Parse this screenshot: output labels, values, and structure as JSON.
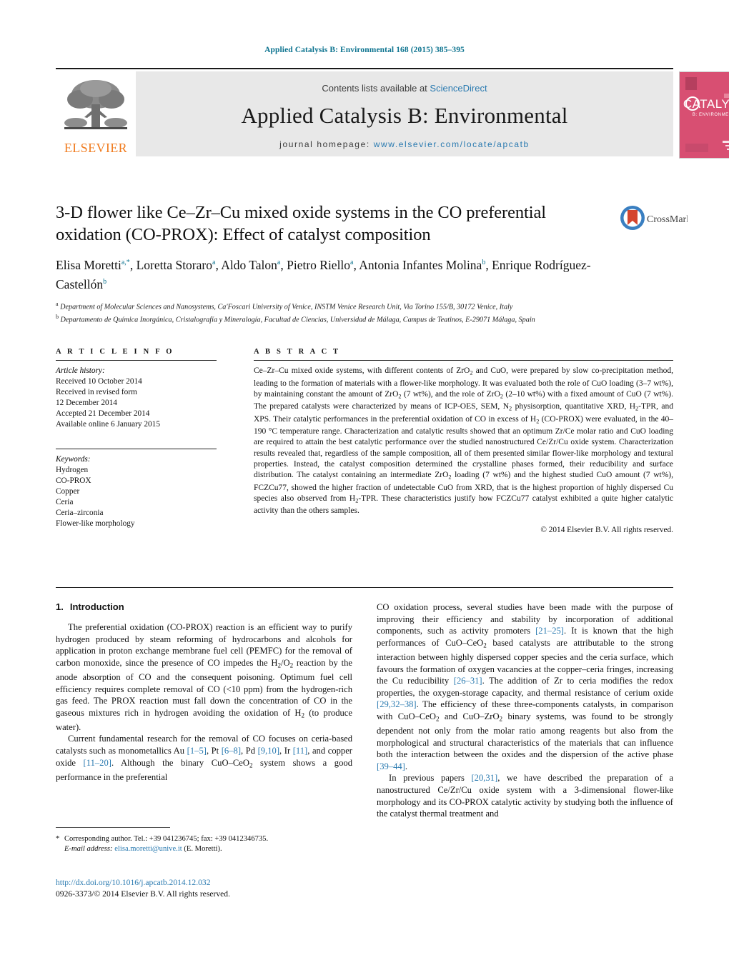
{
  "running_head": "Applied Catalysis B: Environmental 168 (2015) 385–395",
  "masthead": {
    "contents_prefix": "Contents lists available at ",
    "contents_link": "ScienceDirect",
    "journal_title": "Applied Catalysis B: Environmental",
    "homepage_prefix": "journal homepage: ",
    "homepage_url": "www.elsevier.com/locate/apcatb",
    "publisher_name": "ELSEVIER",
    "cover_title": "CATALYSIS",
    "cover_subtitle": "B: ENVIRONMENTAL"
  },
  "crossmark": {
    "label": "CrossMark"
  },
  "article": {
    "title": "3-D flower like Ce–Zr–Cu mixed oxide systems in the CO preferential oxidation (CO-PROX): Effect of catalyst composition",
    "authors_html": "Elisa Moretti<sup>a,*</sup>, Loretta Storaro<sup>a</sup>, Aldo Talon<sup>a</sup>, Pietro Riello<sup>a</sup>, Antonia Infantes Molina<sup>b</sup>, Enrique Rodríguez-Castellón<sup>b</sup>",
    "affiliation_a": "Department of Molecular Sciences and Nanosystems, Ca'Foscari University of Venice, INSTM Venice Research Unit, Via Torino 155/B, 30172 Venice, Italy",
    "affiliation_b": "Departamento de Química Inorgánica, Cristalografía y Mineralogía, Facultad de Ciencias, Universidad de Málaga, Campus de Teatinos, E-29071 Málaga, Spain"
  },
  "article_info": {
    "heading": "A R T I C L E   I N F O",
    "history_title": "Article history:",
    "history": [
      "Received 10 October 2014",
      "Received in revised form",
      "12 December 2014",
      "Accepted 21 December 2014",
      "Available online 6 January 2015"
    ],
    "keywords_title": "Keywords:",
    "keywords": [
      "Hydrogen",
      "CO-PROX",
      "Copper",
      "Ceria",
      "Ceria–zirconia",
      "Flower-like morphology"
    ]
  },
  "abstract": {
    "heading": "A B S T R A C T",
    "text_html": "Ce–Zr–Cu mixed oxide systems, with different contents of ZrO<sub>2</sub> and CuO, were prepared by slow co-precipitation method, leading to the formation of materials with a flower-like morphology. It was evaluated both the role of CuO loading (3–7 wt%), by maintaining constant the amount of ZrO<sub>2</sub> (7 wt%), and the role of ZrO<sub>2</sub> (2–10 wt%) with a fixed amount of CuO (7 wt%). The prepared catalysts were characterized by means of ICP-OES, SEM, N<sub>2</sub> physisorption, quantitative XRD, H<sub>2</sub>-TPR, and XPS. Their catalytic performances in the preferential oxidation of CO in excess of H<sub>2</sub> (CO-PROX) were evaluated, in the 40–190 °C temperature range. Characterization and catalytic results showed that an optimum Zr/Ce molar ratio and CuO loading are required to attain the best catalytic performance over the studied nanostructured Ce/Zr/Cu oxide system. Characterization results revealed that, regardless of the sample composition, all of them presented similar flower-like morphology and textural properties. Instead, the catalyst composition determined the crystalline phases formed, their reducibility and surface distribution. The catalyst containing an intermediate ZrO<sub>2</sub> loading (7 wt%) and the highest studied CuO amount (7 wt%), FCZCu77, showed the higher fraction of undetectable CuO from XRD, that is the highest proportion of highly dispersed Cu species also observed from H<sub>2</sub>-TPR. These characteristics justify how FCZCu77 catalyst exhibited a quite higher catalytic activity than the others samples.",
    "copyright": "© 2014 Elsevier B.V. All rights reserved."
  },
  "introduction": {
    "number": "1.",
    "title": "Introduction",
    "left_paragraphs_html": [
      "The preferential oxidation (CO-PROX) reaction is an efficient way to purify hydrogen produced by steam reforming of hydrocarbons and alcohols for application in proton exchange membrane fuel cell (PEMFC) for the removal of carbon monoxide, since the presence of CO impedes the H<sub>2</sub>/O<sub>2</sub> reaction by the anode absorption of CO and the consequent poisoning. Optimum fuel cell efficiency requires complete removal of CO (&lt;10 ppm) from the hydrogen-rich gas feed. The PROX reaction must fall down the concentration of CO in the gaseous mixtures rich in hydrogen avoiding the oxidation of H<sub>2</sub> (to produce water).",
      "Current fundamental research for the removal of CO focuses on ceria-based catalysts such as monometallics Au <span class=\"ref\">[1–5]</span>, Pt <span class=\"ref\">[6–8]</span>, Pd <span class=\"ref\">[9,10]</span>, Ir <span class=\"ref\">[11]</span>, and copper oxide <span class=\"ref\">[11–20]</span>. Although the binary CuO–CeO<sub>2</sub> system shows a good performance in the preferential"
    ],
    "right_paragraphs_html": [
      "CO oxidation process, several studies have been made with the purpose of improving their efficiency and stability by incorporation of additional components, such as activity promoters <span class=\"ref\">[21–25]</span>. It is known that the high performances of CuO–CeO<sub>2</sub> based catalysts are attributable to the strong interaction between highly dispersed copper species and the ceria surface, which favours the formation of oxygen vacancies at the copper–ceria fringes, increasing the Cu reducibility <span class=\"ref\">[26–31]</span>. The addition of Zr to ceria modifies the redox properties, the oxygen-storage capacity, and thermal resistance of cerium oxide <span class=\"ref\">[29,32–38]</span>. The efficiency of these three-components catalysts, in comparison with CuO–CeO<sub>2</sub> and CuO–ZrO<sub>2</sub> binary systems, was found to be strongly dependent not only from the molar ratio among reagents but also from the morphological and structural characteristics of the materials that can influence both the interaction between the oxides and the dispersion of the active phase <span class=\"ref\">[39–44]</span>.",
      "In previous papers <span class=\"ref\">[20,31]</span>, we have described the preparation of a nanostructured Ce/Zr/Cu oxide system with a 3-dimensional flower-like morphology and its CO-PROX catalytic activity by studying both the influence of the catalyst thermal treatment and"
    ]
  },
  "footnotes": {
    "corresponding_html": "<span class=\"star\">*</span> Corresponding author. Tel.: +39 041236745; fax: +39 0412346735.",
    "email_label": "E-mail address:",
    "email": "elisa.moretti@unive.it",
    "email_suffix": "(E. Moretti).",
    "doi": "http://dx.doi.org/10.1016/j.apcatb.2014.12.032",
    "issn_html": "0926-3373/© 2014 Elsevier B.V. All rights reserved."
  },
  "colors": {
    "link": "#2a7ab0",
    "runhead": "#0e7490",
    "elsevier_orange": "#f07c20",
    "cover_pink": "#d84f72"
  }
}
